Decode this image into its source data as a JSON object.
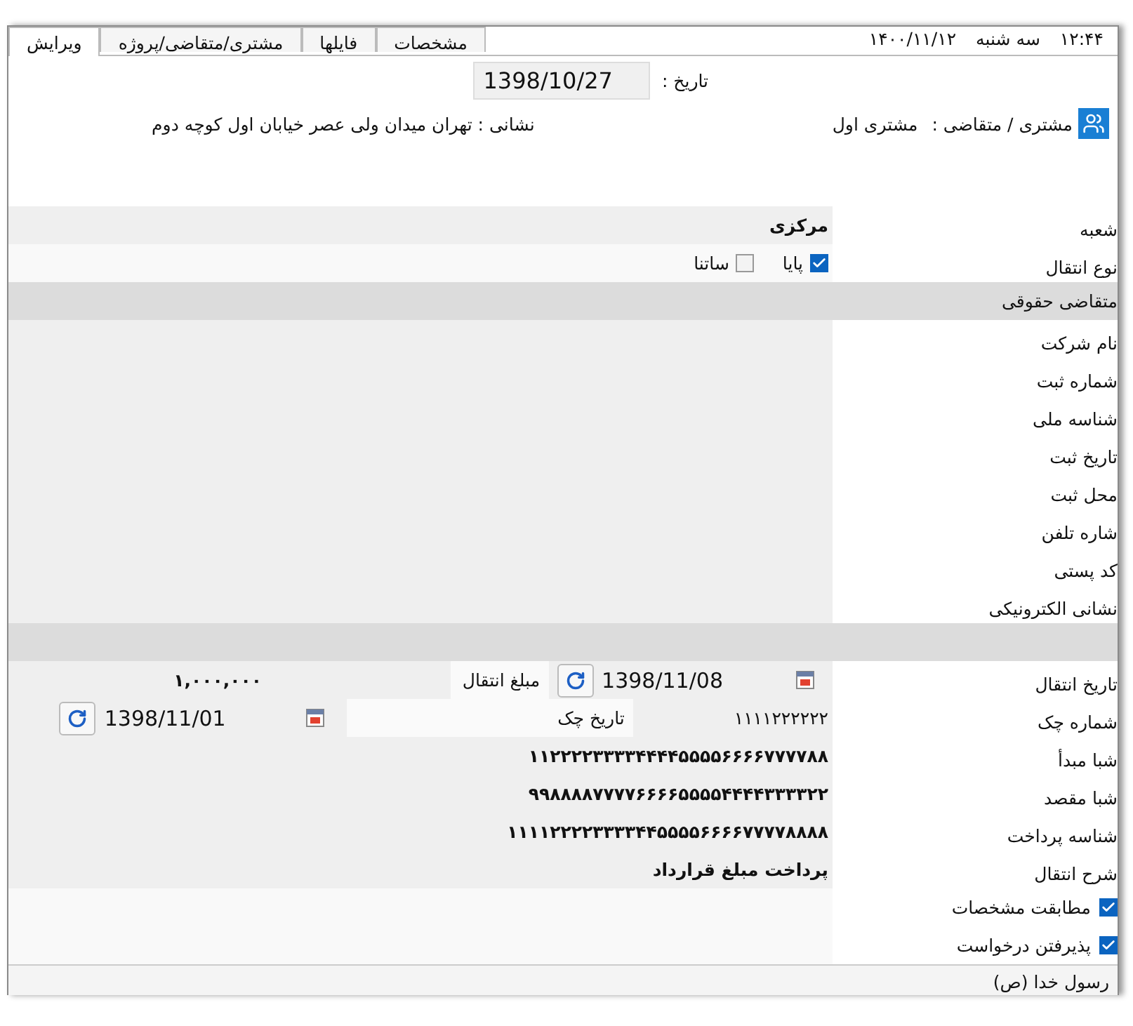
{
  "status": {
    "time": "۱۲:۴۴",
    "day": "سه شنبه",
    "date": "۱۴۰۰/۱۱/۱۲"
  },
  "tabs": [
    {
      "label": "مشخصات",
      "selected": false
    },
    {
      "label": "فایلها",
      "selected": false
    },
    {
      "label": "مشتری/متقاضی/پروژه",
      "selected": false
    },
    {
      "label": "ویرایش",
      "selected": true
    }
  ],
  "header": {
    "date_label": "تاریخ :",
    "date": "1398/10/27",
    "customer_label": "مشتری / متقاضی :",
    "customer": "مشتری اول",
    "address": "نشانی : تهران میدان ولی عصر خیابان اول کوچه دوم"
  },
  "rows": [
    {
      "kind": "text",
      "label": "شعبه",
      "value": "مرکزی"
    },
    {
      "kind": "options",
      "label": "نوع انتقال",
      "options": [
        {
          "label": "پایا",
          "checked": true
        },
        {
          "label": "ساتنا",
          "checked": false
        }
      ]
    },
    {
      "kind": "section",
      "label": "متقاضی حقوقی"
    },
    {
      "kind": "text",
      "label": "نام شرکت"
    },
    {
      "kind": "text",
      "label": "شماره ثبت"
    },
    {
      "kind": "text",
      "label": "شناسه ملی"
    },
    {
      "kind": "text",
      "label": "تاریخ ثبت"
    },
    {
      "kind": "text",
      "label": "محل ثبت"
    },
    {
      "kind": "text",
      "label": "شاره تلفن"
    },
    {
      "kind": "text",
      "label": "کد پستی"
    },
    {
      "kind": "text",
      "label": "نشانی الکترونیکی"
    },
    {
      "kind": "section"
    },
    {
      "kind": "transfer",
      "label": "تاریخ انتقال",
      "date": "1398/11/08",
      "amount_label": "مبلغ انتقال",
      "amount": "۱,۰۰۰,۰۰۰"
    },
    {
      "kind": "cheque",
      "label": "شماره چک",
      "value": "۱۱۱۱۲۲۲۲۲۲",
      "date_label": "تاریخ چک",
      "date": "1398/11/01"
    },
    {
      "kind": "text",
      "label": "شبا مبدأ",
      "value": "۱۱۲۲۲۲۳۳۳۳۴۴۴۴۵۵۵۵۶۶۶۶۷۷۷۷۸۸"
    },
    {
      "kind": "text",
      "label": "شبا مقصد",
      "value": "۹۹۸۸۸۸۷۷۷۷۶۶۶۶۵۵۵۵۴۴۴۴۳۳۳۳۲۲"
    },
    {
      "kind": "text",
      "label": "شناسه پرداخت",
      "value": "۱۱۱۱۲۲۲۲۳۳۳۳۴۴۵۵۵۵۶۶۶۶۷۷۷۷۸۸۸۸"
    },
    {
      "kind": "text",
      "label": "شرح انتقال",
      "value": "پرداخت مبلغ قرارداد"
    },
    {
      "kind": "check",
      "label": "مطابقت مشخصات",
      "checked": true
    },
    {
      "kind": "check",
      "label": "پذیرفتن درخواست",
      "checked": true
    }
  ],
  "footer": "رسول خدا (ص)"
}
